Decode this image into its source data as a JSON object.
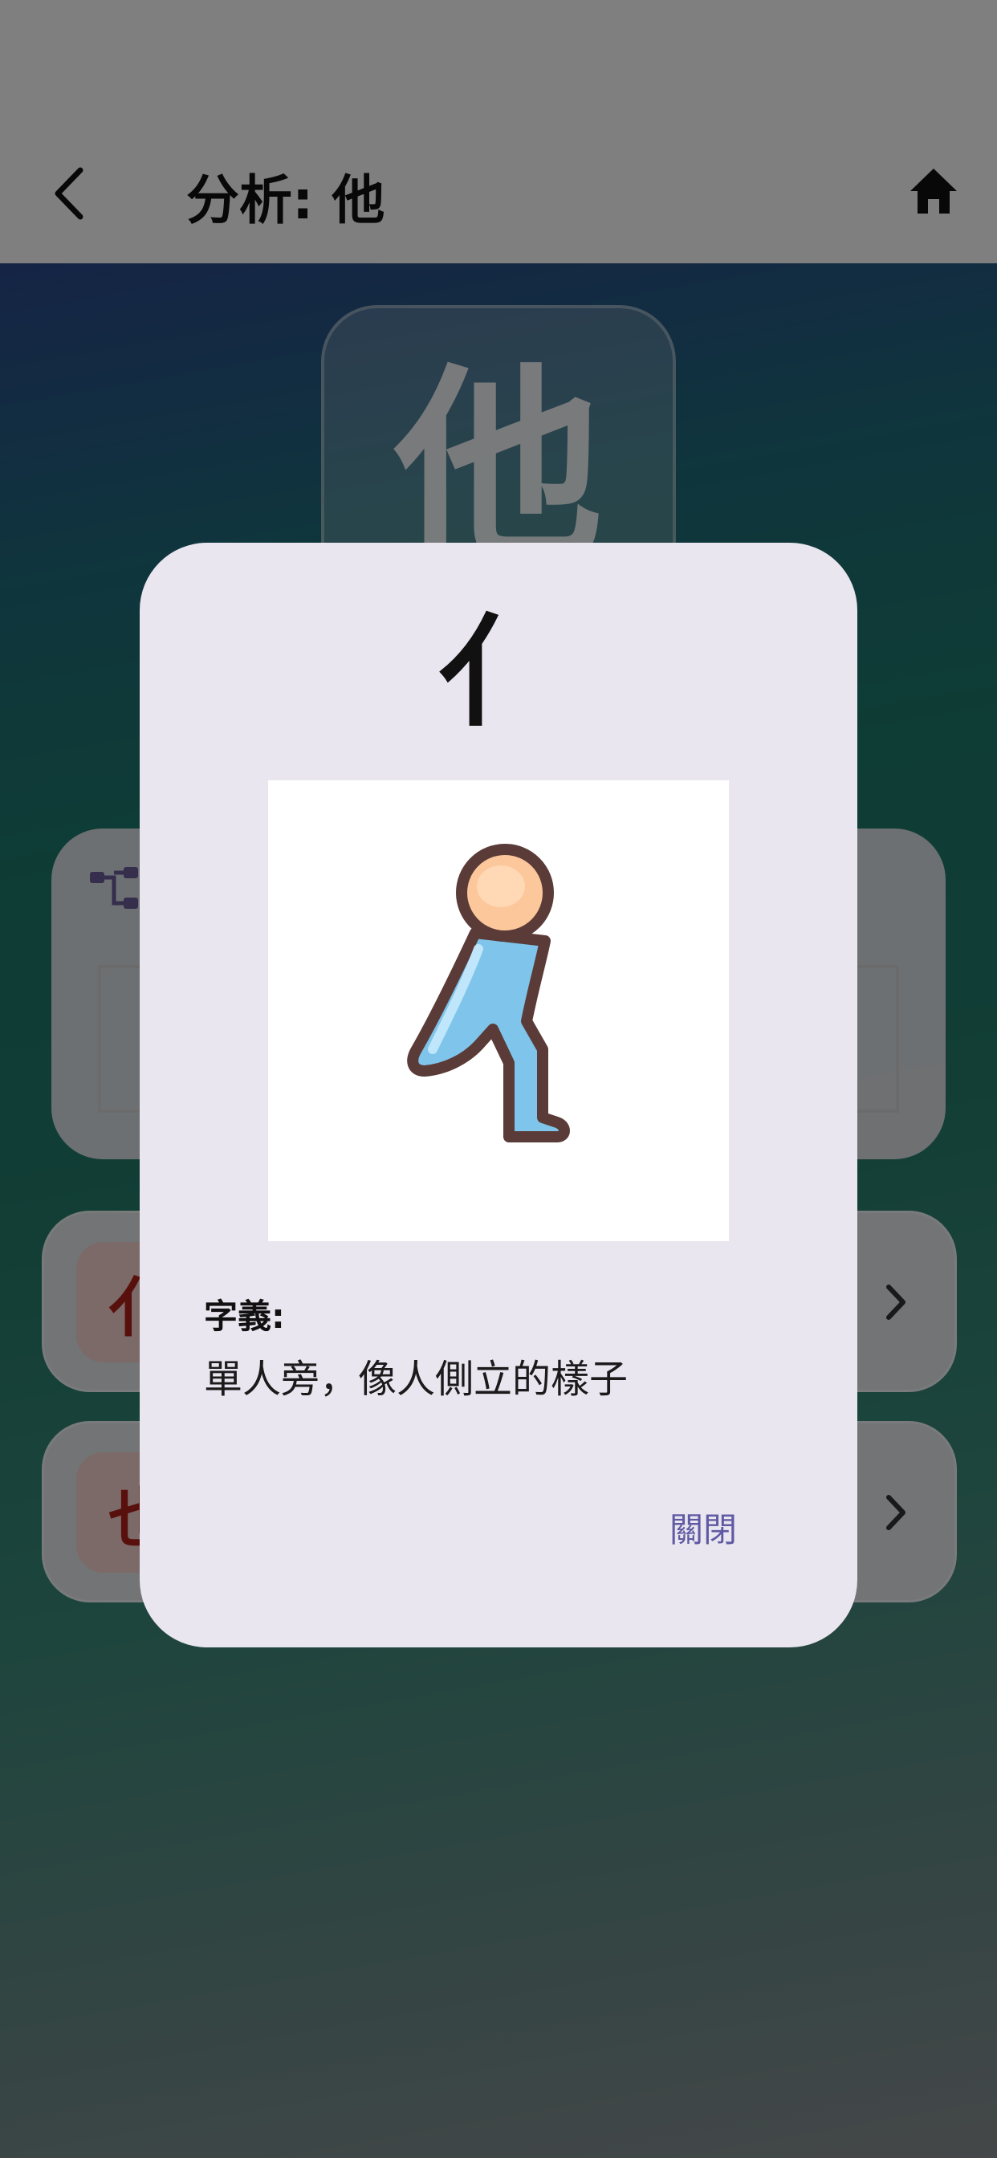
{
  "appbar": {
    "title": "分析: 他",
    "back_icon": "back-arrow-icon",
    "home_icon": "home-icon"
  },
  "main": {
    "big_character": "他",
    "components": [
      {
        "badge": "亻"
      },
      {
        "badge": "也"
      }
    ]
  },
  "dialog": {
    "title": "亻",
    "image_icon": "standing-person-icon",
    "meaning_label": "字義:",
    "meaning_text": "單人旁，像人側立的樣子",
    "close_label": "關閉"
  },
  "colors": {
    "accent": "#5f5aa3",
    "badge_bg": "#f6d4d0",
    "badge_text": "#b0211a",
    "dialog_bg": "#eae6ef"
  }
}
